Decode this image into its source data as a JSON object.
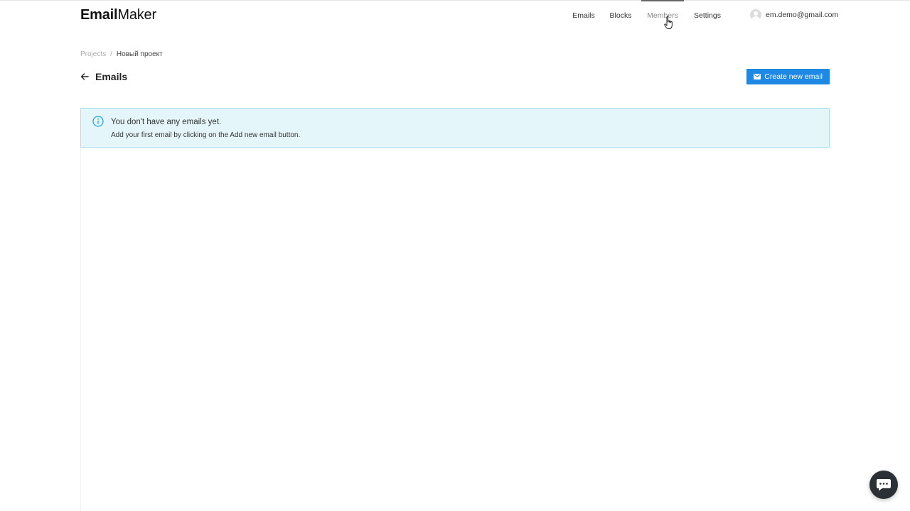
{
  "app": {
    "logo_bold": "Email",
    "logo_light": "Maker"
  },
  "nav": {
    "items": [
      {
        "label": "Emails"
      },
      {
        "label": "Blocks"
      },
      {
        "label": "Members"
      },
      {
        "label": "Settings"
      }
    ],
    "active": "Members"
  },
  "user": {
    "email": "em.demo@gmail.com"
  },
  "breadcrumb": {
    "root": "Projects",
    "separator": "/",
    "current": "Новый проект"
  },
  "page": {
    "title": "Emails",
    "create_button_label": "Create new email"
  },
  "alert": {
    "title": "You don't have any emails yet.",
    "text": "Add your first email by clicking on the Add new email button."
  },
  "colors": {
    "primary": "#1e88e5",
    "alert_bg": "#e5f6fb",
    "alert_border": "#a9dff0",
    "info_icon": "#1aa3d9",
    "chat_bg": "#2b2f36"
  },
  "icons": {
    "back": "arrow-left-icon",
    "mail": "mail-icon",
    "info": "info-icon",
    "chat": "chat-icon",
    "avatar": "avatar-icon"
  }
}
